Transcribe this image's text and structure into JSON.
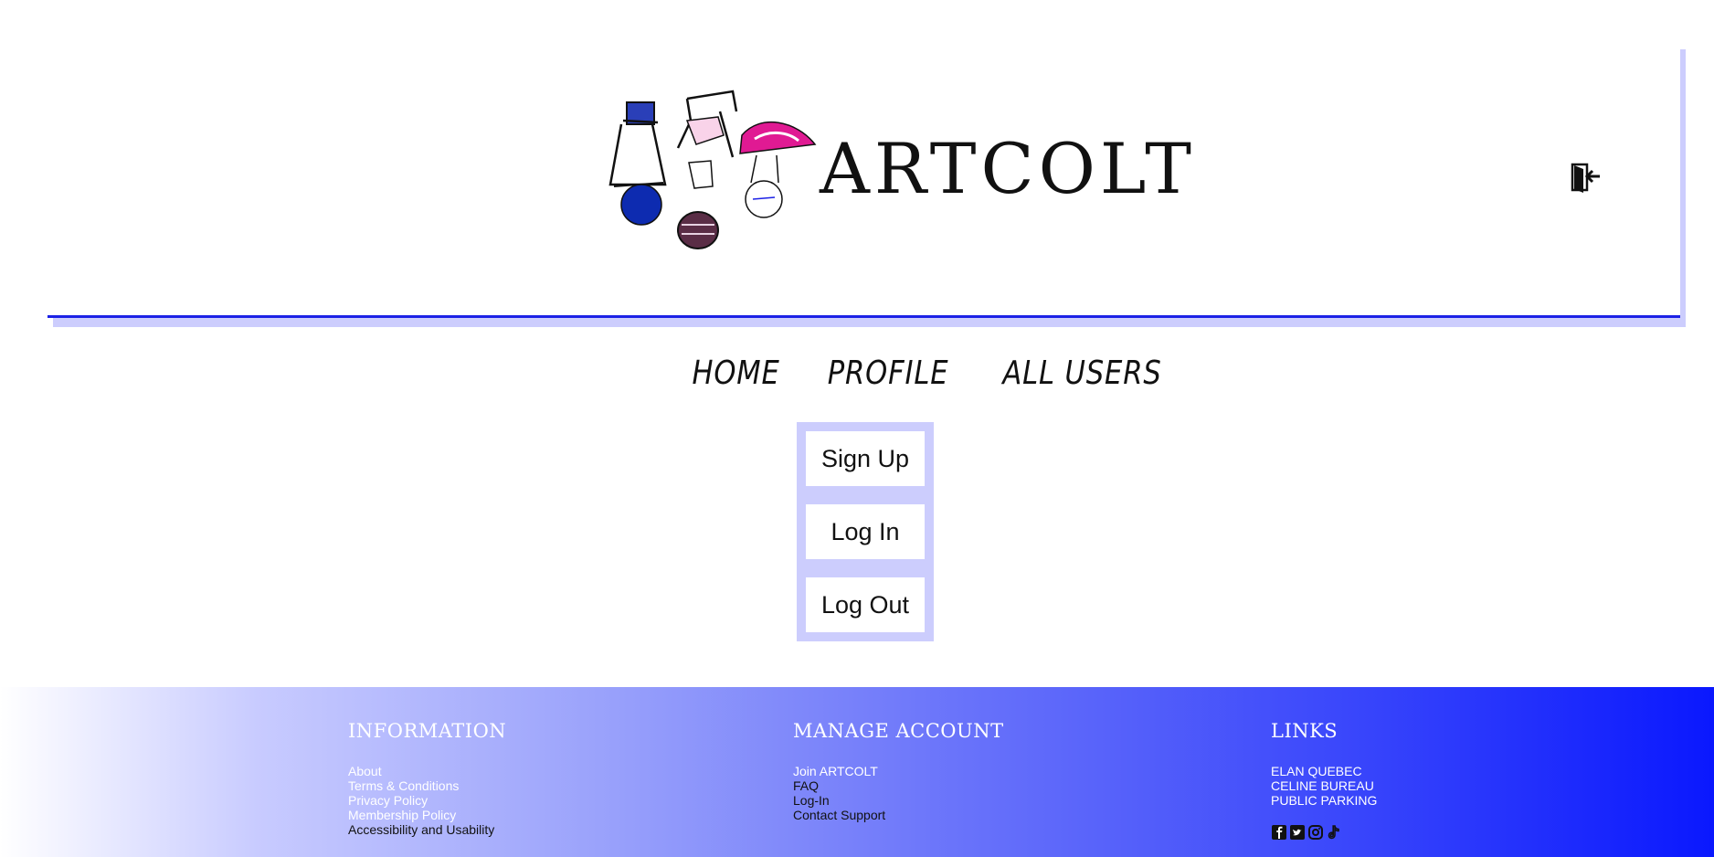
{
  "brand": {
    "name": "ARTCOLT",
    "logo_icon": "illustrated-lamps-logo"
  },
  "header": {
    "logout_icon": "door-exit-icon"
  },
  "nav": {
    "items": [
      {
        "label": "HOME"
      },
      {
        "label": "PROFILE"
      },
      {
        "label": "ALL USERS"
      }
    ]
  },
  "auth": {
    "sign_up": "Sign Up",
    "log_in": "Log In",
    "log_out": "Log Out"
  },
  "footer": {
    "information": {
      "title": "INFORMATION",
      "links": [
        "About",
        "Terms & Conditions",
        "Privacy Policy",
        "Membership Policy",
        "Accessibility and Usability"
      ]
    },
    "manage": {
      "title": "MANAGE ACCOUNT",
      "links": [
        "Join ARTCOLT",
        "FAQ",
        "Log-In",
        "Contact Support"
      ]
    },
    "links": {
      "title": "LINKS",
      "links": [
        "ELAN QUEBEC",
        "CELINE BUREAU",
        "PUBLIC PARKING"
      ],
      "social_icons": [
        "facebook-icon",
        "twitter-icon",
        "instagram-icon",
        "tiktok-icon"
      ]
    }
  },
  "colors": {
    "accent": "#1c21e6",
    "panel": "#cccdfd",
    "footer_end": "#0a18fe"
  }
}
